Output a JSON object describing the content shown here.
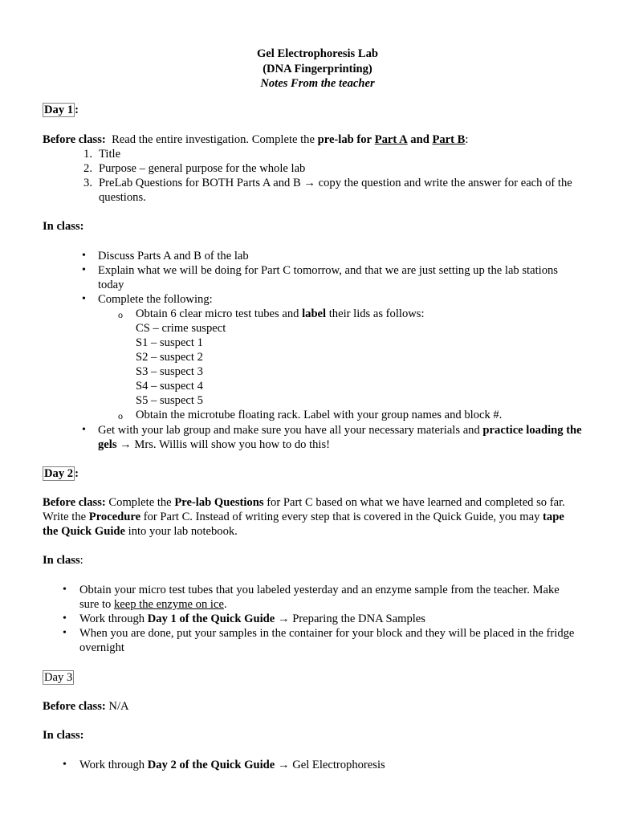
{
  "document": {
    "title": "Gel Electrophoresis Lab",
    "subtitle": "(DNA Fingerprinting)",
    "byline": "Notes From the teacher"
  },
  "glyphs": {
    "arrow": "→",
    "bullet": "•",
    "circle": "o",
    "colon": ":"
  },
  "day1": {
    "heading": "Day 1",
    "before_label": "Before class:",
    "before_text": "Read the entire investigation.  Complete the",
    "before_bold": "pre-lab for",
    "part_a": "Part A",
    "and_text": "and",
    "part_b": "Part B",
    "numbered": [
      {
        "num": "1.",
        "text": "Title"
      },
      {
        "num": "2.",
        "text": "Purpose – general purpose for the whole lab"
      },
      {
        "num": "3.",
        "text": "PreLab Questions for BOTH Parts A and B",
        "after": "copy the question and write the answer for each of the",
        "cont": "questions."
      }
    ],
    "in_class_label": "In class:",
    "bullets": {
      "b1": "Discuss Parts A and B of the lab",
      "b2_line1": "Explain what we will be doing for Part C tomorrow, and that we are just setting up the lab stations",
      "b2_line2": "today",
      "b3": "Complete the following:",
      "sub1_pre": "Obtain 6 clear micro test tubes and",
      "sub1_bold": "label",
      "sub1_post": "their lids as follows:",
      "labels": [
        "CS – crime suspect",
        "S1 – suspect 1",
        "S2 – suspect 2",
        "S3 – suspect 3",
        "S4 – suspect 4",
        "S5 – suspect 5"
      ],
      "sub2": "Obtain the microtube floating rack.  Label with your group names and block #.",
      "b4_pre": "Get with your lab group and make sure you have all your necessary materials and",
      "b4_bold": "practice loading the",
      "b4_bold2": "gels",
      "b4_post": "Mrs. Willis will show you how to do this!"
    }
  },
  "day2": {
    "heading": "Day 2",
    "before_label": "Before class:",
    "p1_a": "Complete the",
    "p1_b": "Pre-lab Questions",
    "p1_c": "for Part C based on what we have learned and completed so far.",
    "p2_a": "Write the",
    "p2_b": "Procedure",
    "p2_c": "for Part C.  Instead of writing every step that is covered in the Quick Guide, you may",
    "p2_d": "tape",
    "p3_a": "the Quick Guide",
    "p3_b": "into your lab notebook.",
    "in_class_label": "In class",
    "bullets": {
      "b1_line1": "Obtain your micro test tubes that you labeled yesterday and an enzyme sample from the teacher.  Make",
      "b1_pre": "sure to",
      "b1_u": "keep the enzyme on ice",
      "b1_post": ".",
      "b2_pre": "Work through",
      "b2_bold": "Day 1 of the Quick Guide",
      "b2_post": "Preparing the DNA Samples",
      "b3_line1": "When you are done, put your samples in the container for your block and they will be placed in the fridge",
      "b3_line2": "overnight"
    }
  },
  "day3": {
    "heading": "Day 3",
    "before_label": "Before class:",
    "before_text": "N/A",
    "in_class_label": "In class:",
    "b1_pre": "Work through",
    "b1_bold": "Day 2 of the Quick Guide",
    "b1_post": "Gel Electrophoresis"
  }
}
